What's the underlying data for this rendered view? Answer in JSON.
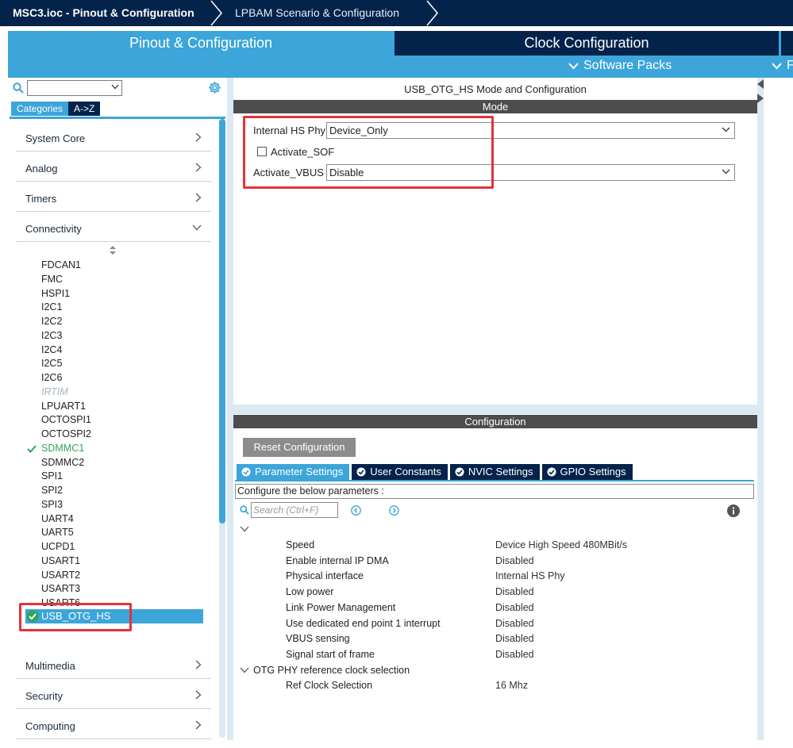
{
  "breadcrumb": {
    "project": "MSC3.ioc - Pinout & Configuration",
    "scenario": "LPBAM Scenario & Configuration"
  },
  "tabs": {
    "pinout": "Pinout & Configuration",
    "clock": "Clock Configuration",
    "software_packs": "Software Packs",
    "more": "F"
  },
  "left": {
    "category_tabs": [
      "Categories",
      "A->Z"
    ],
    "categories_top": [
      "System Core",
      "Analog",
      "Timers",
      "Connectivity"
    ],
    "peripherals": [
      {
        "label": "FDCAN1",
        "state": "normal"
      },
      {
        "label": "FMC",
        "state": "normal"
      },
      {
        "label": "HSPI1",
        "state": "normal"
      },
      {
        "label": "I2C1",
        "state": "normal"
      },
      {
        "label": "I2C2",
        "state": "normal"
      },
      {
        "label": "I2C3",
        "state": "normal"
      },
      {
        "label": "I2C4",
        "state": "normal"
      },
      {
        "label": "I2C5",
        "state": "normal"
      },
      {
        "label": "I2C6",
        "state": "normal"
      },
      {
        "label": "IRTIM",
        "state": "disabled"
      },
      {
        "label": "LPUART1",
        "state": "normal"
      },
      {
        "label": "OCTOSPI1",
        "state": "normal"
      },
      {
        "label": "OCTOSPI2",
        "state": "normal"
      },
      {
        "label": "SDMMC1",
        "state": "ok"
      },
      {
        "label": "SDMMC2",
        "state": "normal"
      },
      {
        "label": "SPI1",
        "state": "normal"
      },
      {
        "label": "SPI2",
        "state": "normal"
      },
      {
        "label": "SPI3",
        "state": "normal"
      },
      {
        "label": "UART4",
        "state": "normal"
      },
      {
        "label": "UART5",
        "state": "normal"
      },
      {
        "label": "UCPD1",
        "state": "normal"
      },
      {
        "label": "USART1",
        "state": "normal"
      },
      {
        "label": "USART2",
        "state": "normal"
      },
      {
        "label": "USART3",
        "state": "normal"
      },
      {
        "label": "USART6",
        "state": "normal"
      }
    ],
    "selected_peripheral": "USB_OTG_HS",
    "categories_bottom": [
      "Multimedia",
      "Security",
      "Computing"
    ]
  },
  "mode": {
    "title": "USB_OTG_HS Mode and Configuration",
    "header": "Mode",
    "internal_hs_phy_label": "Internal HS Phy",
    "internal_hs_phy_value": "Device_Only",
    "activate_sof_label": "Activate_SOF",
    "activate_sof_checked": false,
    "activate_vbus_label": "Activate_VBUS",
    "activate_vbus_value": "Disable"
  },
  "config": {
    "header": "Configuration",
    "reset_label": "Reset Configuration",
    "tabs": [
      "Parameter Settings",
      "User Constants",
      "NVIC Settings",
      "GPIO Settings"
    ],
    "hint": "Configure the below parameters :",
    "search_placeholder": "Search (Ctrl+F)",
    "params": [
      {
        "name": "Speed",
        "value": "Device High Speed 480MBit/s"
      },
      {
        "name": "Enable internal IP DMA",
        "value": "Disabled"
      },
      {
        "name": "Physical interface",
        "value": "Internal HS Phy"
      },
      {
        "name": "Low power",
        "value": "Disabled"
      },
      {
        "name": "Link Power Management",
        "value": "Disabled"
      },
      {
        "name": "Use dedicated end point 1 interrupt",
        "value": "Disabled"
      },
      {
        "name": "VBUS sensing",
        "value": "Disabled"
      },
      {
        "name": "Signal start of frame",
        "value": "Disabled"
      }
    ],
    "group2_title": "OTG PHY reference clock selection",
    "group2_params": [
      {
        "name": "Ref Clock Selection",
        "value": "16 Mhz"
      }
    ]
  },
  "colors": {
    "navy": "#03234b",
    "accent": "#3ca5d9",
    "ok_green": "#2ea55a",
    "highlight_red": "#e4323a"
  }
}
